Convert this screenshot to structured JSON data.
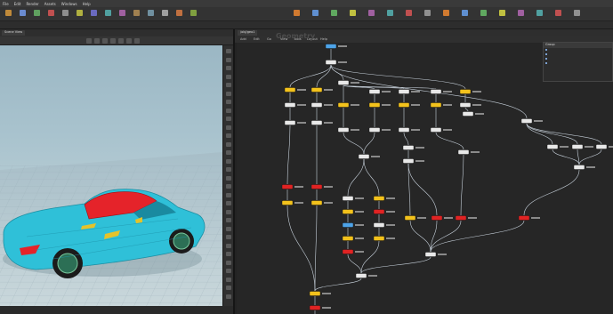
{
  "menubar": {
    "items": [
      "File",
      "Edit",
      "Render",
      "Assets",
      "Windows",
      "Help"
    ]
  },
  "shelf": {
    "tools": [
      {
        "name": "box",
        "color": "#c08a3a"
      },
      {
        "name": "sphere",
        "color": "#6a8bd0"
      },
      {
        "name": "tube",
        "color": "#5fa05f"
      },
      {
        "name": "torus",
        "color": "#c05050"
      },
      {
        "name": "grid",
        "color": "#8e8e8e"
      },
      {
        "name": "null",
        "color": "#b0b040"
      },
      {
        "name": "line",
        "color": "#6a6ac0"
      },
      {
        "name": "circle",
        "color": "#50a0a0"
      },
      {
        "name": "curve",
        "color": "#a060a0"
      },
      {
        "name": "path",
        "color": "#a08050"
      },
      {
        "name": "spray",
        "color": "#7090a0"
      },
      {
        "name": "font",
        "color": "#a0a0a0"
      },
      {
        "name": "platonic",
        "color": "#c07040"
      },
      {
        "name": "lsys",
        "color": "#80a040"
      }
    ]
  },
  "viewport": {
    "tab": "Scene View",
    "car_body_color": "#2fc0d8",
    "car_highlight_color": "#e5232a",
    "ground_color": "#b9ccd2"
  },
  "network": {
    "tab": "/obj/geo1",
    "menu": [
      "Add",
      "Edit",
      "Go",
      "View",
      "Tools",
      "Layout",
      "Help"
    ],
    "label_context": "Geometry",
    "accent_wire": "#c8d2dc",
    "node_yellow": "#f3c21c",
    "node_red": "#e02323",
    "node_white": "#e8e8e8",
    "node_blue": "#4da3e8",
    "param_panel": {
      "title": "Group",
      "rows": [
        "",
        "",
        "",
        ""
      ]
    }
  }
}
